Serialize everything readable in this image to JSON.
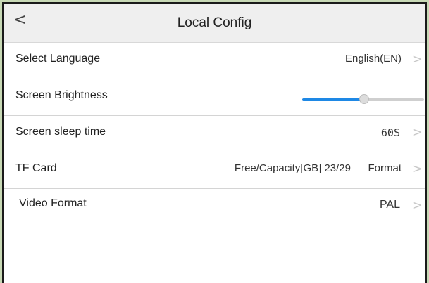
{
  "header": {
    "title": "Local Config",
    "back_glyph": "<",
    "back_icon": "chevron-left-icon"
  },
  "rows": [
    {
      "label": "Select Language",
      "value": "English(EN)"
    },
    {
      "label": "Screen Brightness",
      "value_fraction": 0.51
    },
    {
      "label": "Screen sleep time",
      "value": "60S"
    },
    {
      "label": "TF Card",
      "value": "Free/Capacity[GB] 23/29",
      "action": "Format"
    },
    {
      "label": "Video Format",
      "value": "PAL"
    }
  ],
  "chevron_glyph": ">",
  "colors": {
    "accent": "#1e88e5",
    "header_bg": "#efefef",
    "outer_bg": "#c8d9b6"
  }
}
